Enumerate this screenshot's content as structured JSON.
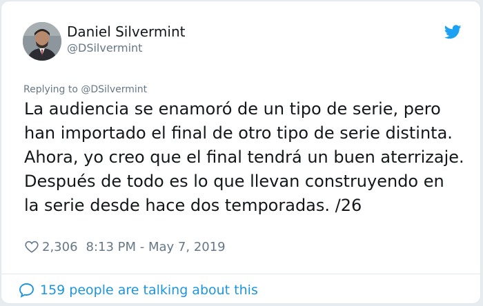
{
  "author": {
    "display_name": "Daniel Silvermint",
    "handle": "@DSilvermint",
    "avatar_icon": "user-avatar-photo"
  },
  "brand": {
    "icon": "twitter-bird-icon",
    "color": "#1da1f2"
  },
  "tweet": {
    "replying_to": "Replying to @DSilvermint",
    "lines": [
      "La audiencia se enamoró de un tipo de serie, pero",
      "han importado el final de otro tipo de serie distinta.",
      "Ahora, yo creo que el final tendrá un buen aterrizaje.",
      "Después de todo es lo que llevan construyendo en",
      "la serie desde hace dos temporadas. /26"
    ],
    "likes": "2,306",
    "timestamp": "8:13 PM - May 7, 2019"
  },
  "footer": {
    "conversation_label": "159 people are talking about this",
    "icon": "chat-bubble-icon",
    "link_color": "#1b95e0"
  }
}
